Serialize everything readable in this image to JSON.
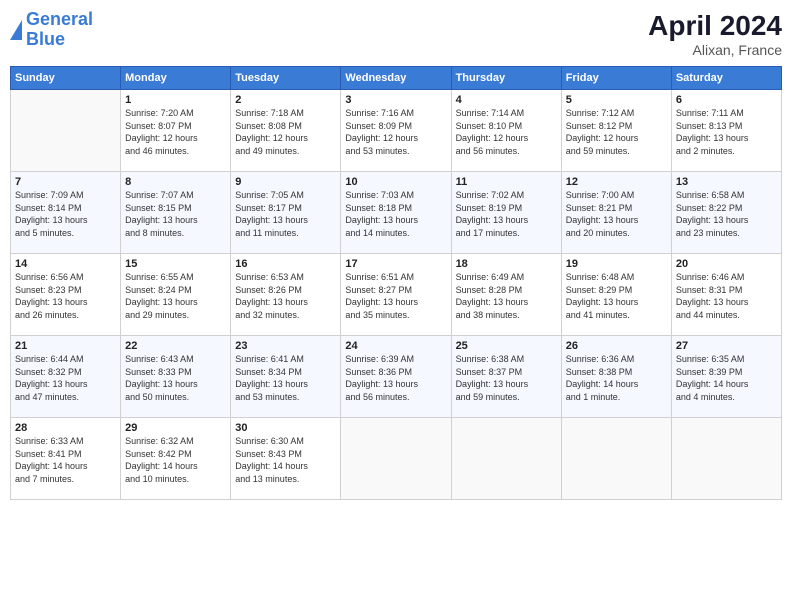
{
  "logo": {
    "line1": "General",
    "line2": "Blue"
  },
  "title": "April 2024",
  "subtitle": "Alixan, France",
  "headers": [
    "Sunday",
    "Monday",
    "Tuesday",
    "Wednesday",
    "Thursday",
    "Friday",
    "Saturday"
  ],
  "weeks": [
    [
      {
        "num": "",
        "info": ""
      },
      {
        "num": "1",
        "info": "Sunrise: 7:20 AM\nSunset: 8:07 PM\nDaylight: 12 hours\nand 46 minutes."
      },
      {
        "num": "2",
        "info": "Sunrise: 7:18 AM\nSunset: 8:08 PM\nDaylight: 12 hours\nand 49 minutes."
      },
      {
        "num": "3",
        "info": "Sunrise: 7:16 AM\nSunset: 8:09 PM\nDaylight: 12 hours\nand 53 minutes."
      },
      {
        "num": "4",
        "info": "Sunrise: 7:14 AM\nSunset: 8:10 PM\nDaylight: 12 hours\nand 56 minutes."
      },
      {
        "num": "5",
        "info": "Sunrise: 7:12 AM\nSunset: 8:12 PM\nDaylight: 12 hours\nand 59 minutes."
      },
      {
        "num": "6",
        "info": "Sunrise: 7:11 AM\nSunset: 8:13 PM\nDaylight: 13 hours\nand 2 minutes."
      }
    ],
    [
      {
        "num": "7",
        "info": "Sunrise: 7:09 AM\nSunset: 8:14 PM\nDaylight: 13 hours\nand 5 minutes."
      },
      {
        "num": "8",
        "info": "Sunrise: 7:07 AM\nSunset: 8:15 PM\nDaylight: 13 hours\nand 8 minutes."
      },
      {
        "num": "9",
        "info": "Sunrise: 7:05 AM\nSunset: 8:17 PM\nDaylight: 13 hours\nand 11 minutes."
      },
      {
        "num": "10",
        "info": "Sunrise: 7:03 AM\nSunset: 8:18 PM\nDaylight: 13 hours\nand 14 minutes."
      },
      {
        "num": "11",
        "info": "Sunrise: 7:02 AM\nSunset: 8:19 PM\nDaylight: 13 hours\nand 17 minutes."
      },
      {
        "num": "12",
        "info": "Sunrise: 7:00 AM\nSunset: 8:21 PM\nDaylight: 13 hours\nand 20 minutes."
      },
      {
        "num": "13",
        "info": "Sunrise: 6:58 AM\nSunset: 8:22 PM\nDaylight: 13 hours\nand 23 minutes."
      }
    ],
    [
      {
        "num": "14",
        "info": "Sunrise: 6:56 AM\nSunset: 8:23 PM\nDaylight: 13 hours\nand 26 minutes."
      },
      {
        "num": "15",
        "info": "Sunrise: 6:55 AM\nSunset: 8:24 PM\nDaylight: 13 hours\nand 29 minutes."
      },
      {
        "num": "16",
        "info": "Sunrise: 6:53 AM\nSunset: 8:26 PM\nDaylight: 13 hours\nand 32 minutes."
      },
      {
        "num": "17",
        "info": "Sunrise: 6:51 AM\nSunset: 8:27 PM\nDaylight: 13 hours\nand 35 minutes."
      },
      {
        "num": "18",
        "info": "Sunrise: 6:49 AM\nSunset: 8:28 PM\nDaylight: 13 hours\nand 38 minutes."
      },
      {
        "num": "19",
        "info": "Sunrise: 6:48 AM\nSunset: 8:29 PM\nDaylight: 13 hours\nand 41 minutes."
      },
      {
        "num": "20",
        "info": "Sunrise: 6:46 AM\nSunset: 8:31 PM\nDaylight: 13 hours\nand 44 minutes."
      }
    ],
    [
      {
        "num": "21",
        "info": "Sunrise: 6:44 AM\nSunset: 8:32 PM\nDaylight: 13 hours\nand 47 minutes."
      },
      {
        "num": "22",
        "info": "Sunrise: 6:43 AM\nSunset: 8:33 PM\nDaylight: 13 hours\nand 50 minutes."
      },
      {
        "num": "23",
        "info": "Sunrise: 6:41 AM\nSunset: 8:34 PM\nDaylight: 13 hours\nand 53 minutes."
      },
      {
        "num": "24",
        "info": "Sunrise: 6:39 AM\nSunset: 8:36 PM\nDaylight: 13 hours\nand 56 minutes."
      },
      {
        "num": "25",
        "info": "Sunrise: 6:38 AM\nSunset: 8:37 PM\nDaylight: 13 hours\nand 59 minutes."
      },
      {
        "num": "26",
        "info": "Sunrise: 6:36 AM\nSunset: 8:38 PM\nDaylight: 14 hours\nand 1 minute."
      },
      {
        "num": "27",
        "info": "Sunrise: 6:35 AM\nSunset: 8:39 PM\nDaylight: 14 hours\nand 4 minutes."
      }
    ],
    [
      {
        "num": "28",
        "info": "Sunrise: 6:33 AM\nSunset: 8:41 PM\nDaylight: 14 hours\nand 7 minutes."
      },
      {
        "num": "29",
        "info": "Sunrise: 6:32 AM\nSunset: 8:42 PM\nDaylight: 14 hours\nand 10 minutes."
      },
      {
        "num": "30",
        "info": "Sunrise: 6:30 AM\nSunset: 8:43 PM\nDaylight: 14 hours\nand 13 minutes."
      },
      {
        "num": "",
        "info": ""
      },
      {
        "num": "",
        "info": ""
      },
      {
        "num": "",
        "info": ""
      },
      {
        "num": "",
        "info": ""
      }
    ]
  ]
}
